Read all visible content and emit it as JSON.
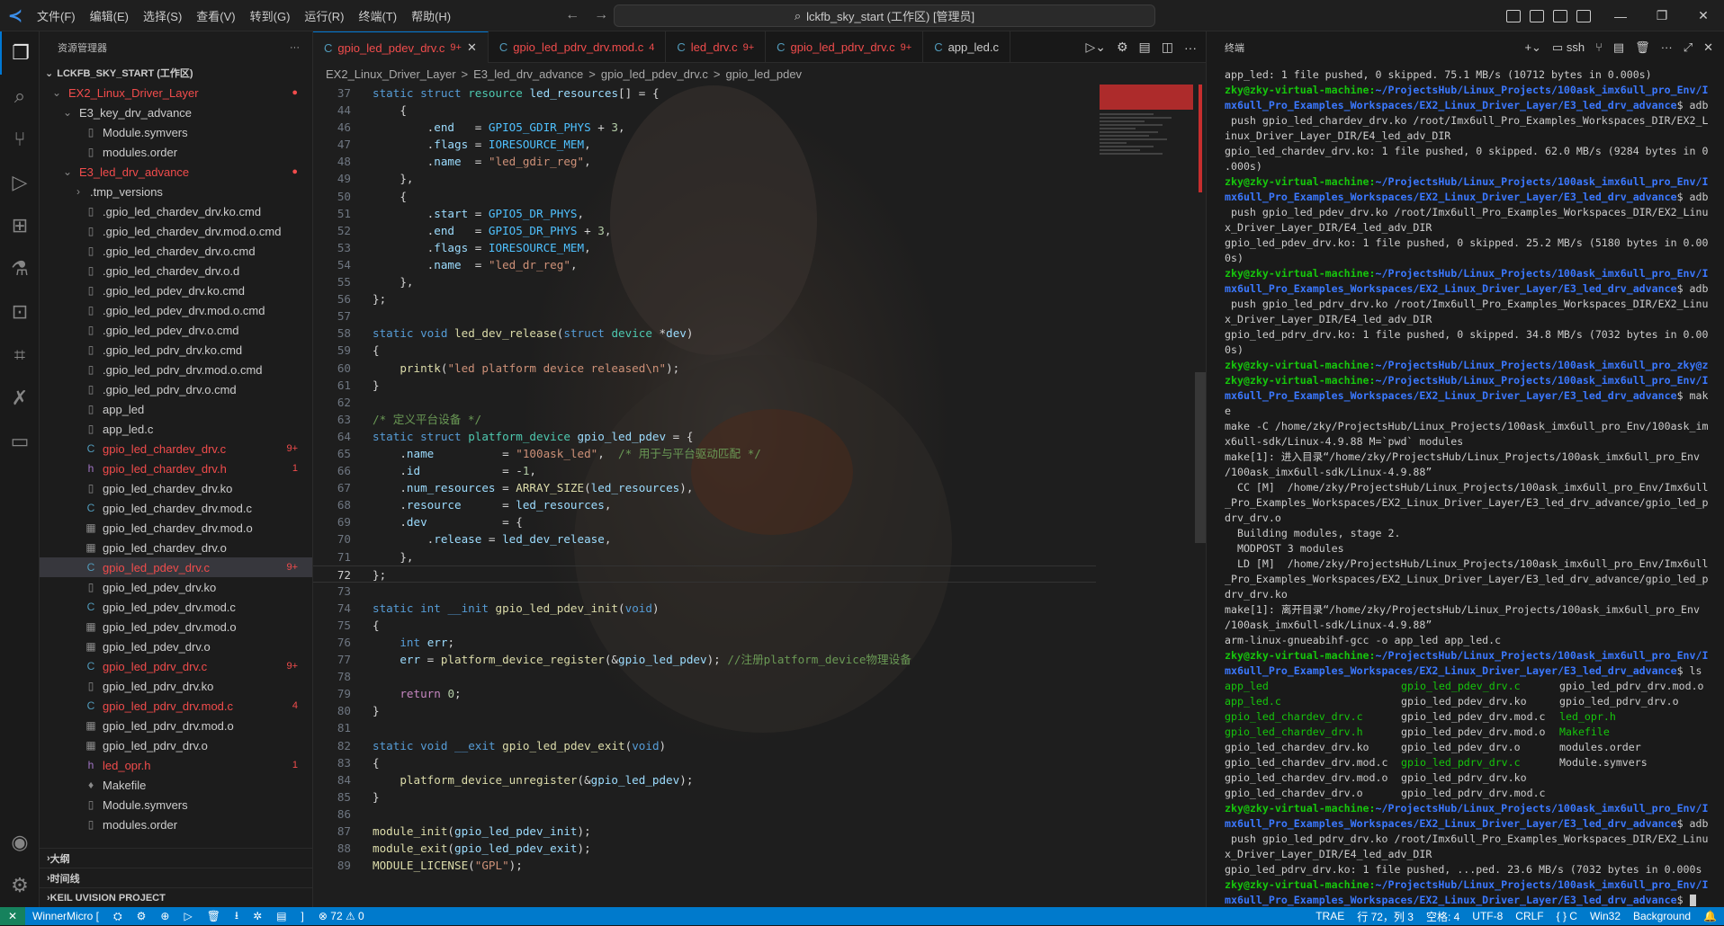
{
  "titlebar": {
    "menu": [
      "文件(F)",
      "编辑(E)",
      "选择(S)",
      "查看(V)",
      "转到(G)",
      "运行(R)",
      "终端(T)",
      "帮助(H)"
    ],
    "search_text": "lckfb_sky_start (工作区) [管理员]"
  },
  "sidebar": {
    "title": "资源管理器",
    "root": "LCKFB_SKY_START (工作区)",
    "items": [
      {
        "label": "EX2_Linux_Driver_Layer",
        "indent": 1,
        "type": "folder",
        "color": "red",
        "badge": "●"
      },
      {
        "label": "E3_key_drv_advance",
        "indent": 2,
        "type": "folder",
        "color": "normal",
        "badge": ""
      },
      {
        "label": "Module.symvers",
        "indent": 3,
        "type": "file",
        "color": "normal",
        "badge": ""
      },
      {
        "label": "modules.order",
        "indent": 3,
        "type": "file",
        "color": "normal",
        "badge": ""
      },
      {
        "label": "E3_led_drv_advance",
        "indent": 2,
        "type": "folder",
        "color": "red",
        "badge": "●"
      },
      {
        "label": ".tmp_versions",
        "indent": 3,
        "type": "folderc",
        "color": "normal",
        "badge": ""
      },
      {
        "label": ".gpio_led_chardev_drv.ko.cmd",
        "indent": 3,
        "type": "file",
        "color": "normal",
        "badge": ""
      },
      {
        "label": ".gpio_led_chardev_drv.mod.o.cmd",
        "indent": 3,
        "type": "file",
        "color": "normal",
        "badge": ""
      },
      {
        "label": ".gpio_led_chardev_drv.o.cmd",
        "indent": 3,
        "type": "file",
        "color": "normal",
        "badge": ""
      },
      {
        "label": ".gpio_led_chardev_drv.o.d",
        "indent": 3,
        "type": "file",
        "color": "normal",
        "badge": ""
      },
      {
        "label": ".gpio_led_pdev_drv.ko.cmd",
        "indent": 3,
        "type": "file",
        "color": "normal",
        "badge": ""
      },
      {
        "label": ".gpio_led_pdev_drv.mod.o.cmd",
        "indent": 3,
        "type": "file",
        "color": "normal",
        "badge": ""
      },
      {
        "label": ".gpio_led_pdev_drv.o.cmd",
        "indent": 3,
        "type": "file",
        "color": "normal",
        "badge": ""
      },
      {
        "label": ".gpio_led_pdrv_drv.ko.cmd",
        "indent": 3,
        "type": "file",
        "color": "normal",
        "badge": ""
      },
      {
        "label": ".gpio_led_pdrv_drv.mod.o.cmd",
        "indent": 3,
        "type": "file",
        "color": "normal",
        "badge": ""
      },
      {
        "label": ".gpio_led_pdrv_drv.o.cmd",
        "indent": 3,
        "type": "file",
        "color": "normal",
        "badge": ""
      },
      {
        "label": "app_led",
        "indent": 3,
        "type": "file",
        "color": "normal",
        "badge": ""
      },
      {
        "label": "app_led.c",
        "indent": 3,
        "type": "file",
        "color": "normal",
        "badge": ""
      },
      {
        "label": "gpio_led_chardev_drv.c",
        "indent": 3,
        "type": "c",
        "color": "red",
        "badge": "9+"
      },
      {
        "label": "gpio_led_chardev_drv.h",
        "indent": 3,
        "type": "h",
        "color": "red",
        "badge": "1"
      },
      {
        "label": "gpio_led_chardev_drv.ko",
        "indent": 3,
        "type": "file",
        "color": "normal",
        "badge": ""
      },
      {
        "label": "gpio_led_chardev_drv.mod.c",
        "indent": 3,
        "type": "c",
        "color": "normal",
        "badge": ""
      },
      {
        "label": "gpio_led_chardev_drv.mod.o",
        "indent": 3,
        "type": "o",
        "color": "normal",
        "badge": ""
      },
      {
        "label": "gpio_led_chardev_drv.o",
        "indent": 3,
        "type": "o",
        "color": "normal",
        "badge": ""
      },
      {
        "label": "gpio_led_pdev_drv.c",
        "indent": 3,
        "type": "c",
        "color": "red",
        "badge": "9+",
        "selected": true
      },
      {
        "label": "gpio_led_pdev_drv.ko",
        "indent": 3,
        "type": "file",
        "color": "normal",
        "badge": ""
      },
      {
        "label": "gpio_led_pdev_drv.mod.c",
        "indent": 3,
        "type": "c",
        "color": "normal",
        "badge": ""
      },
      {
        "label": "gpio_led_pdev_drv.mod.o",
        "indent": 3,
        "type": "o",
        "color": "normal",
        "badge": ""
      },
      {
        "label": "gpio_led_pdev_drv.o",
        "indent": 3,
        "type": "o",
        "color": "normal",
        "badge": ""
      },
      {
        "label": "gpio_led_pdrv_drv.c",
        "indent": 3,
        "type": "c",
        "color": "red",
        "badge": "9+"
      },
      {
        "label": "gpio_led_pdrv_drv.ko",
        "indent": 3,
        "type": "file",
        "color": "normal",
        "badge": ""
      },
      {
        "label": "gpio_led_pdrv_drv.mod.c",
        "indent": 3,
        "type": "c",
        "color": "red",
        "badge": "4"
      },
      {
        "label": "gpio_led_pdrv_drv.mod.o",
        "indent": 3,
        "type": "o",
        "color": "normal",
        "badge": ""
      },
      {
        "label": "gpio_led_pdrv_drv.o",
        "indent": 3,
        "type": "o",
        "color": "normal",
        "badge": ""
      },
      {
        "label": "led_opr.h",
        "indent": 3,
        "type": "h",
        "color": "red",
        "badge": "1"
      },
      {
        "label": "Makefile",
        "indent": 3,
        "type": "mk",
        "color": "normal",
        "badge": ""
      },
      {
        "label": "Module.symvers",
        "indent": 3,
        "type": "file",
        "color": "normal",
        "badge": ""
      },
      {
        "label": "modules.order",
        "indent": 3,
        "type": "file",
        "color": "normal",
        "badge": ""
      }
    ],
    "footer": [
      "大纲",
      "时间线",
      "KEIL UVISION PROJECT"
    ]
  },
  "tabs": [
    {
      "label": "gpio_led_pdev_drv.c",
      "mark": "9+",
      "active": true,
      "close": "✕"
    },
    {
      "label": "gpio_led_pdrv_drv.mod.c",
      "mark": "4",
      "active": false,
      "close": ""
    },
    {
      "label": "led_drv.c",
      "mark": "9+",
      "active": false,
      "close": ""
    },
    {
      "label": "gpio_led_pdrv_drv.c",
      "mark": "9+",
      "active": false,
      "close": ""
    },
    {
      "label": "app_led.c",
      "mark": "",
      "active": false,
      "close": ""
    }
  ],
  "breadcrumb": [
    "EX2_Linux_Driver_Layer",
    ">",
    "E3_led_drv_advance",
    ">",
    "gpio_led_pdev_drv.c",
    ">",
    "gpio_led_pdev"
  ],
  "code": [
    {
      "n": "37",
      "h": "<span class='k'>static</span> <span class='k'>struct</span> <span class='t'>resource</span> <span class='v'>led_resources</span>[] = {"
    },
    {
      "n": "44",
      "h": "    {"
    },
    {
      "n": "46",
      "h": "        .<span class='v'>end</span>   = <span class='m'>GPIO5_GDIR_PHYS</span> + <span class='n'>3</span>,"
    },
    {
      "n": "47",
      "h": "        .<span class='v'>flags</span> = <span class='m'>IORESOURCE_MEM</span>,"
    },
    {
      "n": "48",
      "h": "        .<span class='v'>name</span>  = <span class='s'>\"led_gdir_reg\"</span>,"
    },
    {
      "n": "49",
      "h": "    },"
    },
    {
      "n": "50",
      "h": "    {"
    },
    {
      "n": "51",
      "h": "        .<span class='v'>start</span> = <span class='m'>GPIO5_DR_PHYS</span>,"
    },
    {
      "n": "52",
      "h": "        .<span class='v'>end</span>   = <span class='m'>GPIO5_DR_PHYS</span> + <span class='n'>3</span>,"
    },
    {
      "n": "53",
      "h": "        .<span class='v'>flags</span> = <span class='m'>IORESOURCE_MEM</span>,"
    },
    {
      "n": "54",
      "h": "        .<span class='v'>name</span>  = <span class='s'>\"led_dr_reg\"</span>,"
    },
    {
      "n": "55",
      "h": "    },"
    },
    {
      "n": "56",
      "h": "};"
    },
    {
      "n": "57",
      "h": ""
    },
    {
      "n": "58",
      "h": "<span class='k'>static</span> <span class='k'>void</span> <span class='f'>led_dev_release</span>(<span class='k'>struct</span> <span class='t'>device</span> *<span class='v'>dev</span>)"
    },
    {
      "n": "59",
      "h": "{"
    },
    {
      "n": "60",
      "h": "    <span class='f'>printk</span>(<span class='s'>\"led platform device released\\n\"</span>);"
    },
    {
      "n": "61",
      "h": "}"
    },
    {
      "n": "62",
      "h": ""
    },
    {
      "n": "63",
      "h": "<span class='c'>/* 定义平台设备 */</span>"
    },
    {
      "n": "64",
      "h": "<span class='k'>static</span> <span class='k'>struct</span> <span class='t'>platform_device</span> <span class='v'>gpio_led_pdev</span> = {"
    },
    {
      "n": "65",
      "h": "    .<span class='v'>name</span>          = <span class='s'>\"100ask_led\"</span>,  <span class='c'>/* 用于与平台驱动匹配 */</span>"
    },
    {
      "n": "66",
      "h": "    .<span class='v'>id</span>            = -<span class='n'>1</span>,"
    },
    {
      "n": "67",
      "h": "    .<span class='v'>num_resources</span> = <span class='f'>ARRAY_SIZE</span>(<span class='v'>led_resources</span>),"
    },
    {
      "n": "68",
      "h": "    .<span class='v'>resource</span>      = <span class='v'>led_resources</span>,"
    },
    {
      "n": "69",
      "h": "    .<span class='v'>dev</span>           = {"
    },
    {
      "n": "70",
      "h": "        .<span class='v'>release</span> = <span class='v'>led_dev_release</span>,"
    },
    {
      "n": "71",
      "h": "    },"
    },
    {
      "n": "72",
      "h": "};",
      "cur": true
    },
    {
      "n": "73",
      "h": ""
    },
    {
      "n": "74",
      "h": "<span class='k'>static</span> <span class='k'>int</span> <span class='k'>__init</span> <span class='f'>gpio_led_pdev_init</span>(<span class='k'>void</span>)"
    },
    {
      "n": "75",
      "h": "{"
    },
    {
      "n": "76",
      "h": "    <span class='k'>int</span> <span class='v'>err</span>;"
    },
    {
      "n": "77",
      "h": "    <span class='v'>err</span> = <span class='f'>platform_device_register</span>(&amp;<span class='v'>gpio_led_pdev</span>); <span class='c'>//注册platform_device物理设备</span>"
    },
    {
      "n": "78",
      "h": ""
    },
    {
      "n": "79",
      "h": "    <span class='p'>return</span> <span class='n'>0</span>;"
    },
    {
      "n": "80",
      "h": "}"
    },
    {
      "n": "81",
      "h": ""
    },
    {
      "n": "82",
      "h": "<span class='k'>static</span> <span class='k'>void</span> <span class='k'>__exit</span> <span class='f'>gpio_led_pdev_exit</span>(<span class='k'>void</span>)"
    },
    {
      "n": "83",
      "h": "{"
    },
    {
      "n": "84",
      "h": "    <span class='f'>platform_device_unregister</span>(&amp;<span class='v'>gpio_led_pdev</span>);"
    },
    {
      "n": "85",
      "h": "}"
    },
    {
      "n": "86",
      "h": ""
    },
    {
      "n": "87",
      "h": "<span class='f'>module_init</span>(<span class='v'>gpio_led_pdev_init</span>);"
    },
    {
      "n": "88",
      "h": "<span class='f'>module_exit</span>(<span class='v'>gpio_led_pdev_exit</span>);"
    },
    {
      "n": "89",
      "h": "<span class='f'>MODULE_LICENSE</span>(<span class='s'>\"GPL\"</span>);"
    }
  ],
  "terminal": {
    "title": "终端",
    "shell": "ssh",
    "lines": [
      {
        "t": "app_led: 1 file pushed, 0 skipped. 75.1 MB/s (10712 bytes in 0.000s)"
      },
      {
        "p": "zky@zky-virtual-machine:",
        "b": "~/ProjectsHub/Linux_Projects/100ask_imx6ull_pro_Env/I"
      },
      {
        "b": "mx6ull_Pro_Examples_Workspaces/EX2_Linux_Driver_Layer/E3_led_drv_advance",
        "t": "$ adb"
      },
      {
        "t": " push gpio_led_chardev_drv.ko /root/Imx6ull_Pro_Examples_Workspaces_DIR/EX2_L"
      },
      {
        "t": "inux_Driver_Layer_DIR/E4_led_adv_DIR"
      },
      {
        "t": "gpio_led_chardev_drv.ko: 1 file pushed, 0 skipped. 62.0 MB/s (9284 bytes in 0"
      },
      {
        "t": ".000s)"
      },
      {
        "p": "zky@zky-virtual-machine:",
        "b": "~/ProjectsHub/Linux_Projects/100ask_imx6ull_pro_Env/I"
      },
      {
        "b": "mx6ull_Pro_Examples_Workspaces/EX2_Linux_Driver_Layer/E3_led_drv_advance",
        "t": "$ adb"
      },
      {
        "t": " push gpio_led_pdev_drv.ko /root/Imx6ull_Pro_Examples_Workspaces_DIR/EX2_Linu"
      },
      {
        "t": "x_Driver_Layer_DIR/E4_led_adv_DIR"
      },
      {
        "t": "gpio_led_pdev_drv.ko: 1 file pushed, 0 skipped. 25.2 MB/s (5180 bytes in 0.00"
      },
      {
        "t": "0s)"
      },
      {
        "p": "zky@zky-virtual-machine:",
        "b": "~/ProjectsHub/Linux_Projects/100ask_imx6ull_pro_Env/I"
      },
      {
        "b": "mx6ull_Pro_Examples_Workspaces/EX2_Linux_Driver_Layer/E3_led_drv_advance",
        "t": "$ adb"
      },
      {
        "t": " push gpio_led_pdrv_drv.ko /root/Imx6ull_Pro_Examples_Workspaces_DIR/EX2_Linu"
      },
      {
        "t": "x_Driver_Layer_DIR/E4_led_adv_DIR"
      },
      {
        "t": "gpio_led_pdrv_drv.ko: 1 file pushed, 0 skipped. 34.8 MB/s (7032 bytes in 0.00"
      },
      {
        "t": "0s)"
      },
      {
        "p": "zky@zky-virtual-machine:",
        "b": "~/ProjectsHub/Linux_Projects/100ask_imx6ull_pro_zky@z"
      },
      {
        "p": "zky@zky-virtual-machine:",
        "b": "~/ProjectsHub/Linux_Projects/100ask_imx6ull_pro_Env/I"
      },
      {
        "b": "mx6ull_Pro_Examples_Workspaces/EX2_Linux_Driver_Layer/E3_led_drv_advance",
        "t": "$ mak"
      },
      {
        "t": "e"
      },
      {
        "t": "make -C /home/zky/ProjectsHub/Linux_Projects/100ask_imx6ull_pro_Env/100ask_im"
      },
      {
        "t": "x6ull-sdk/Linux-4.9.88 M=`pwd` modules"
      },
      {
        "t": "make[1]: 进入目录“/home/zky/ProjectsHub/Linux_Projects/100ask_imx6ull_pro_Env"
      },
      {
        "t": "/100ask_imx6ull-sdk/Linux-4.9.88”"
      },
      {
        "t": "  CC [M]  /home/zky/ProjectsHub/Linux_Projects/100ask_imx6ull_pro_Env/Imx6ull"
      },
      {
        "t": "_Pro_Examples_Workspaces/EX2_Linux_Driver_Layer/E3_led_drv_advance/gpio_led_p"
      },
      {
        "t": "drv_drv.o"
      },
      {
        "t": "  Building modules, stage 2."
      },
      {
        "t": "  MODPOST 3 modules"
      },
      {
        "t": "  LD [M]  /home/zky/ProjectsHub/Linux_Projects/100ask_imx6ull_pro_Env/Imx6ull"
      },
      {
        "t": "_Pro_Examples_Workspaces/EX2_Linux_Driver_Layer/E3_led_drv_advance/gpio_led_p"
      },
      {
        "t": "drv_drv.ko"
      },
      {
        "t": "make[1]: 离开目录“/home/zky/ProjectsHub/Linux_Projects/100ask_imx6ull_pro_Env"
      },
      {
        "t": "/100ask_imx6ull-sdk/Linux-4.9.88”"
      },
      {
        "t": "arm-linux-gnueabihf-gcc -o app_led app_led.c"
      },
      {
        "p": "zky@zky-virtual-machine:",
        "b": "~/ProjectsHub/Linux_Projects/100ask_imx6ull_pro_Env/I"
      },
      {
        "b": "mx6ull_Pro_Examples_Workspaces/EX2_Linux_Driver_Layer/E3_led_drv_advance",
        "t": "$ ls"
      }
    ],
    "ls": [
      [
        {
          "t": "app_led",
          "c": "g"
        },
        {
          "t": "gpio_led_pdev_drv.c",
          "c": "g"
        },
        {
          "t": "gpio_led_pdrv_drv.mod.o",
          "c": ""
        }
      ],
      [
        {
          "t": "app_led.c",
          "c": "g"
        },
        {
          "t": "gpio_led_pdev_drv.ko",
          "c": ""
        },
        {
          "t": "gpio_led_pdrv_drv.o",
          "c": ""
        }
      ],
      [
        {
          "t": "gpio_led_chardev_drv.c",
          "c": "g"
        },
        {
          "t": "gpio_led_pdev_drv.mod.c",
          "c": ""
        },
        {
          "t": "led_opr.h",
          "c": "g"
        }
      ],
      [
        {
          "t": "gpio_led_chardev_drv.h",
          "c": "g"
        },
        {
          "t": "gpio_led_pdev_drv.mod.o",
          "c": ""
        },
        {
          "t": "Makefile",
          "c": "g"
        }
      ],
      [
        {
          "t": "gpio_led_chardev_drv.ko",
          "c": ""
        },
        {
          "t": "gpio_led_pdev_drv.o",
          "c": ""
        },
        {
          "t": "modules.order",
          "c": ""
        }
      ],
      [
        {
          "t": "gpio_led_chardev_drv.mod.c",
          "c": ""
        },
        {
          "t": "gpio_led_pdrv_drv.c",
          "c": "g"
        },
        {
          "t": "Module.symvers",
          "c": ""
        }
      ],
      [
        {
          "t": "gpio_led_chardev_drv.mod.o",
          "c": ""
        },
        {
          "t": "gpio_led_pdrv_drv.ko",
          "c": ""
        },
        {
          "t": "",
          "c": ""
        }
      ],
      [
        {
          "t": "gpio_led_chardev_drv.o",
          "c": ""
        },
        {
          "t": "gpio_led_pdrv_drv.mod.c",
          "c": ""
        },
        {
          "t": "",
          "c": ""
        }
      ]
    ],
    "lines2": [
      {
        "p": "zky@zky-virtual-machine:",
        "b": "~/ProjectsHub/Linux_Projects/100ask_imx6ull_pro_Env/I"
      },
      {
        "b": "mx6ull_Pro_Examples_Workspaces/EX2_Linux_Driver_Layer/E3_led_drv_advance",
        "t": "$ adb"
      },
      {
        "t": " push gpio_led_pdrv_drv.ko /root/Imx6ull_Pro_Examples_Workspaces_DIR/EX2_Linu"
      },
      {
        "t": "x_Driver_Layer_DIR/E4_led_adv_DIR"
      },
      {
        "t": "gpio_led_pdrv_drv.ko: 1 file pushed, ...ped. 23.6 MB/s (7032 bytes in 0.000s"
      },
      {
        "p": "zky@zky-virtual-machine:",
        "b": "~/ProjectsHub/Linux_Projects/100ask_imx6ull_pro_Env/I"
      },
      {
        "b": "mx6ull_Pro_Examples_Workspaces/EX2_Linux_Driver_Layer/E3_led_drv_advance",
        "t": "$ "
      }
    ]
  },
  "statusbar": {
    "left": [
      "WinnerMicro [",
      "]"
    ],
    "problems": "⊗ 72 ⚠ 0",
    "right": [
      "TRAE",
      "行 72，列 3",
      "空格: 4",
      "UTF-8",
      "CRLF",
      "{ } C",
      "Win32",
      "Background"
    ]
  }
}
